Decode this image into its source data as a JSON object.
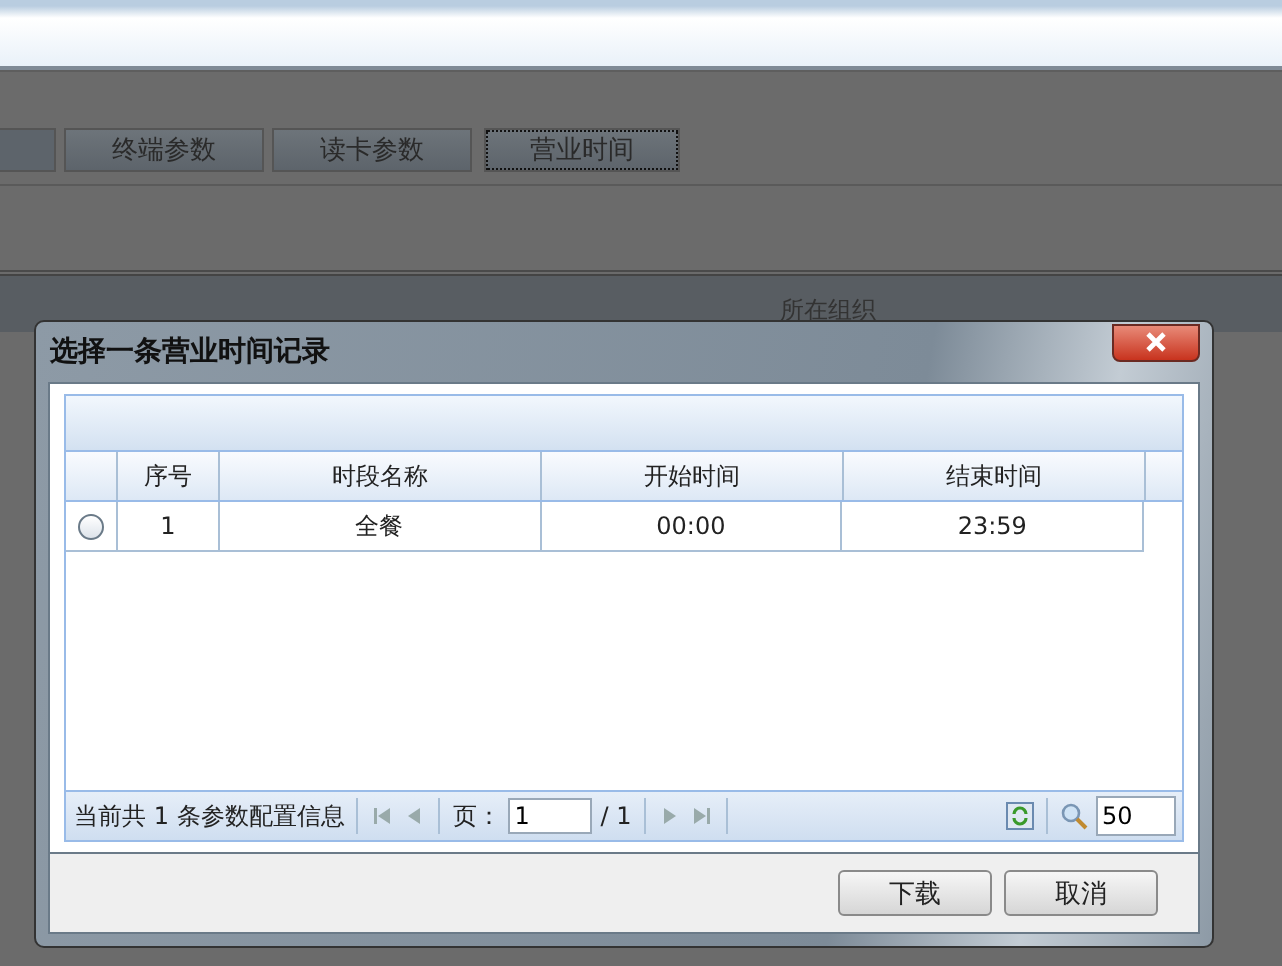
{
  "backdrop": {
    "tabs": [
      {
        "label": "终端参数",
        "selected": false
      },
      {
        "label": "读卡参数",
        "selected": false
      },
      {
        "label": "营业时间",
        "selected": true
      }
    ],
    "grid_columns": [
      "所在组织"
    ]
  },
  "dialog": {
    "title": "选择一条营业时间记录",
    "columns": [
      "序号",
      "时段名称",
      "开始时间",
      "结束时间"
    ],
    "rows": [
      {
        "selected": false,
        "cells": [
          "1",
          "全餐",
          "00:00",
          "23:59"
        ]
      }
    ],
    "pager": {
      "summary": "当前共 1 条参数配置信息",
      "page_label": "页：",
      "page": "1",
      "total": "/ 1",
      "page_size": "50"
    },
    "buttons": [
      "下载",
      "取消"
    ]
  }
}
